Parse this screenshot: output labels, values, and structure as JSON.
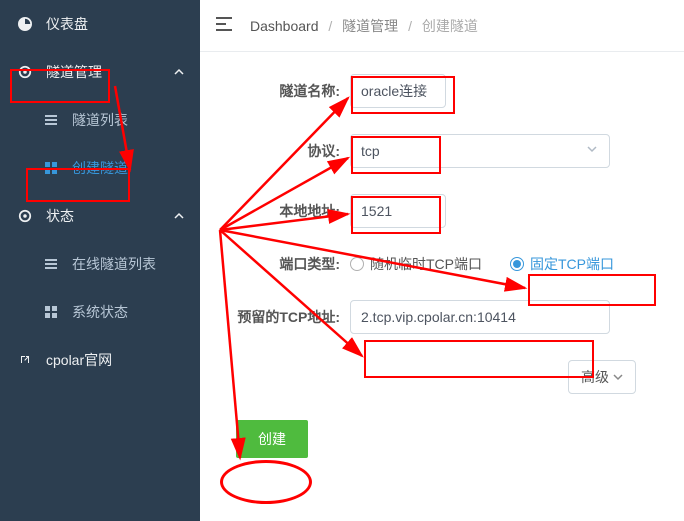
{
  "sidebar": {
    "dashboard": "仪表盘",
    "tunnel_mgmt": "隧道管理",
    "tunnel_list": "隧道列表",
    "create_tunnel": "创建隧道",
    "status": "状态",
    "online_tunnel_list": "在线隧道列表",
    "system_status": "系统状态",
    "cpolar_site": "cpolar官网"
  },
  "breadcrumb": {
    "dashboard": "Dashboard",
    "tunnel_mgmt": "隧道管理",
    "create_tunnel": "创建隧道"
  },
  "form": {
    "tunnel_name_label": "隧道名称:",
    "tunnel_name_value": "oracle连接",
    "protocol_label": "协议:",
    "protocol_value": "tcp",
    "local_addr_label": "本地地址:",
    "local_addr_value": "1521",
    "port_type_label": "端口类型:",
    "port_type_random": "随机临时TCP端口",
    "port_type_fixed": "固定TCP端口",
    "reserved_tcp_label": "预留的TCP地址:",
    "reserved_tcp_value": "2.tcp.vip.cpolar.cn:10414",
    "advanced": "高级",
    "create": "创建"
  }
}
